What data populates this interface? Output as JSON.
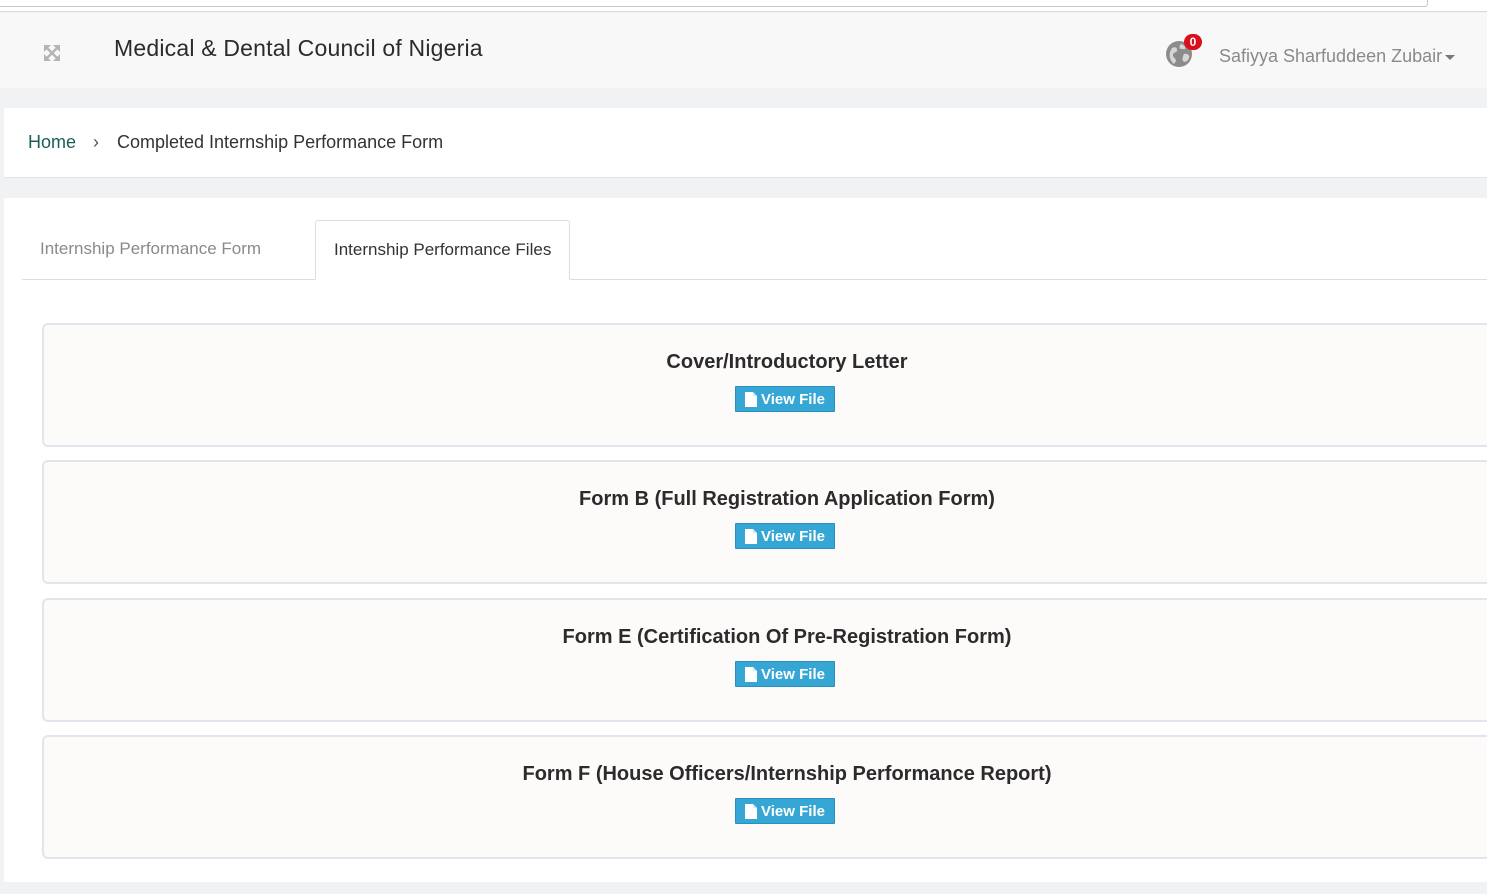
{
  "app": {
    "title": "Medical & Dental Council of Nigeria",
    "notification_count": "0",
    "user_name": "Safiyya Sharfuddeen Zubair"
  },
  "breadcrumb": {
    "home": "Home",
    "separator": "›",
    "current": "Completed Internship Performance Form"
  },
  "tabs": [
    {
      "label": "Internship Performance Form",
      "active": false
    },
    {
      "label": "Internship Performance Files",
      "active": true
    }
  ],
  "files": [
    {
      "title": "Cover/Introductory Letter",
      "button": "View File"
    },
    {
      "title": "Form B (Full Registration Application Form)",
      "button": "View File"
    },
    {
      "title": "Form E (Certification Of Pre-Registration Form)",
      "button": "View File"
    },
    {
      "title": "Form F (House Officers/Internship Performance Report)",
      "button": "View File"
    }
  ],
  "icons": {
    "expand": "expand-arrows-icon",
    "notifications": "globe-icon",
    "dropdown": "caret-down-icon",
    "file": "file-icon"
  },
  "colors": {
    "brand_link": "#1b5e5a",
    "button": "#36a6d4",
    "badge": "#d9101b"
  }
}
